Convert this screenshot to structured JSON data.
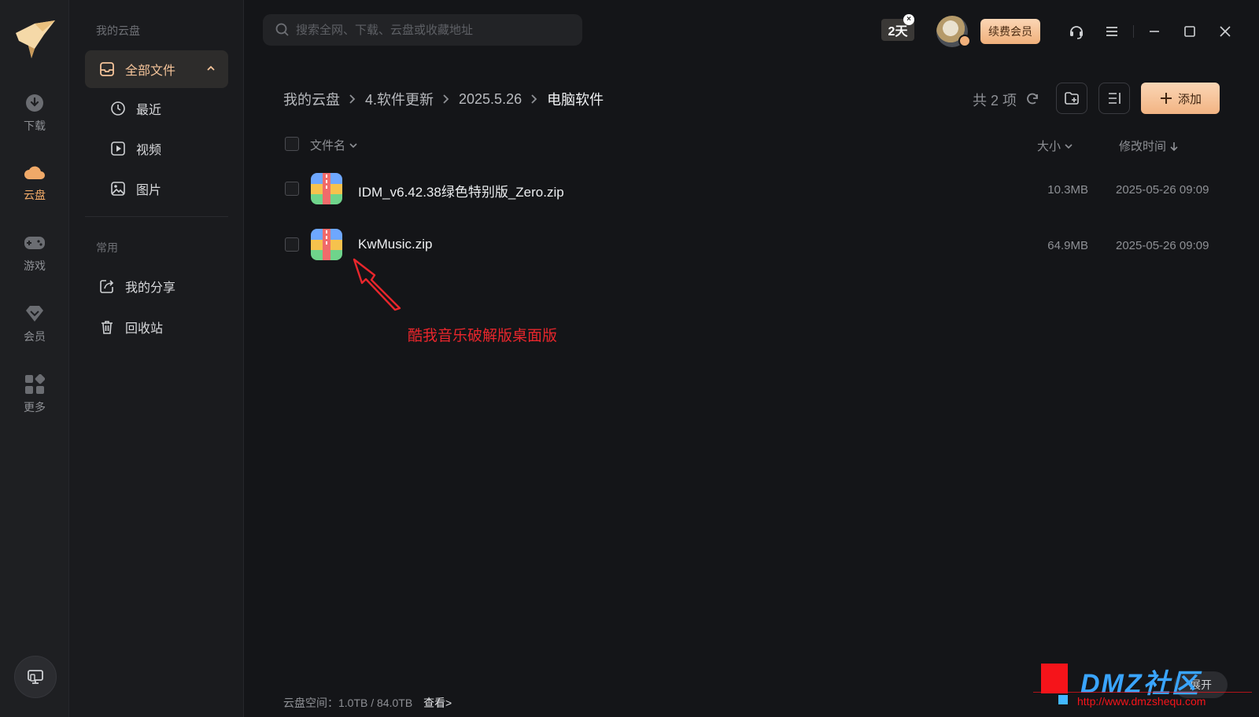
{
  "rail": {
    "items": [
      {
        "label": "下载",
        "icon": "download-icon"
      },
      {
        "label": "云盘",
        "icon": "cloud-icon",
        "active": true
      },
      {
        "label": "游戏",
        "icon": "gamepad-icon"
      },
      {
        "label": "会员",
        "icon": "diamond-icon"
      },
      {
        "label": "更多",
        "icon": "apps-icon"
      }
    ]
  },
  "nav": {
    "section_cloud": "我的云盘",
    "all_files": "全部文件",
    "recent": "最近",
    "video": "视频",
    "images": "图片",
    "section_common": "常用",
    "my_share": "我的分享",
    "recycle_bin": "回收站"
  },
  "topbar": {
    "search_placeholder": "搜索全网、下载、云盘或收藏地址",
    "days_badge": "2天",
    "vip_label": "续费会员"
  },
  "breadcrumb": [
    "我的云盘",
    "4.软件更新",
    "2025.5.26",
    "电脑软件"
  ],
  "toolbar": {
    "count_label": "共 2 项",
    "add_label": "添加"
  },
  "list": {
    "headers": {
      "name": "文件名",
      "size": "大小",
      "modified": "修改时间"
    },
    "rows": [
      {
        "name": "IDM_v6.42.38绿色特别版_Zero.zip",
        "size": "10.3MB",
        "modified": "2025-05-26 09:09",
        "icon": "zip-archive-icon"
      },
      {
        "name": "KwMusic.zip",
        "size": "64.9MB",
        "modified": "2025-05-26 09:09",
        "icon": "zip-archive-icon"
      }
    ]
  },
  "annotation": {
    "text": "酷我音乐破解版桌面版",
    "color": "#e8262c"
  },
  "footer": {
    "space_label": "云盘空间：1.0TB / 84.0TB",
    "view_label": "查看>"
  },
  "expand_label": "展开",
  "watermark": {
    "title": "DMZ社区",
    "url": "http://www.dmzshequ.com"
  },
  "colors": {
    "accent": "#f0a968",
    "background": "#141518",
    "vip_gradient_start": "#fbd6b5",
    "vip_gradient_end": "#f0b07b"
  }
}
